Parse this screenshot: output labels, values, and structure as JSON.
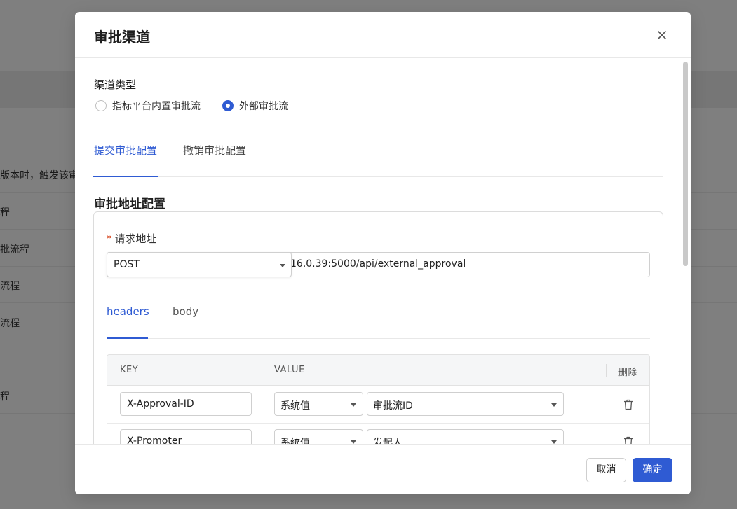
{
  "background": {
    "row_texts": [
      "版本时，触发该审",
      "程",
      "批流程",
      "流程",
      "流程",
      "程"
    ]
  },
  "modal": {
    "title": "审批渠道",
    "close_icon": "close-icon"
  },
  "channel_type": {
    "label": "渠道类型",
    "options": [
      "指标平台内置审批流",
      "外部审批流"
    ],
    "selected": "外部审批流"
  },
  "tabs": {
    "items": [
      "提交审批配置",
      "撤销审批配置"
    ],
    "active": "提交审批配置"
  },
  "section": {
    "title": "审批地址配置"
  },
  "request": {
    "label": "请求地址",
    "required_mark": "*",
    "method": "POST",
    "url": "16.0.39:5000/api/external_approval"
  },
  "subtabs": {
    "items": [
      "headers",
      "body"
    ],
    "active": "headers"
  },
  "table": {
    "headers": [
      "KEY",
      "VALUE",
      "删除"
    ],
    "rows": [
      {
        "key": "X-Approval-ID",
        "source": "系统值",
        "value": "审批流ID"
      },
      {
        "key": "X-Promoter",
        "source": "系统值",
        "value": "发起人"
      }
    ]
  },
  "footer": {
    "cancel": "取消",
    "ok": "确定"
  },
  "colors": {
    "primary": "#2f5bd3",
    "required": "#d4380d"
  }
}
